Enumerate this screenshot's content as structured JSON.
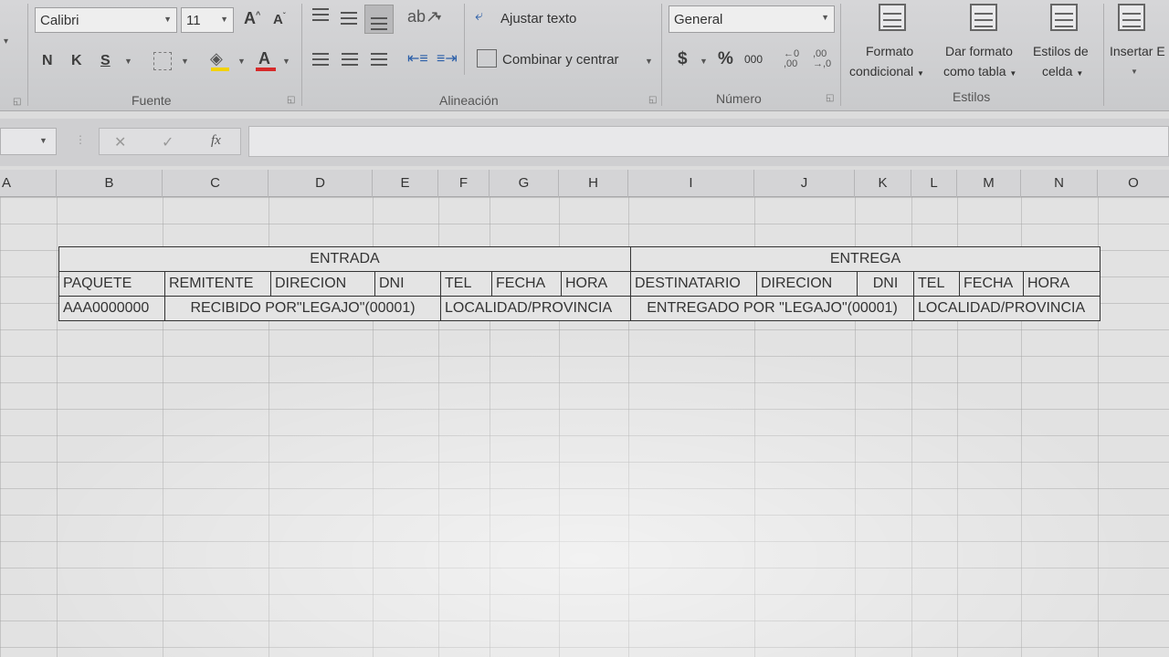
{
  "ribbon": {
    "font": {
      "name": "Calibri",
      "size": "11",
      "increase_font_label": "A",
      "decrease_font_label": "A",
      "bold_label": "N",
      "italic_label": "K",
      "underline_label": "S",
      "group_label": "Fuente",
      "font_color": "#d62a2a"
    },
    "alignment": {
      "wrap_text_label": "Ajustar texto",
      "merge_center_label": "Combinar y centrar",
      "group_label": "Alineación"
    },
    "number": {
      "format": "General",
      "currency_label": "$",
      "percent_label": "%",
      "thousands_label": "000",
      "group_label": "Número"
    },
    "styles": {
      "conditional_label_1": "Formato",
      "conditional_label_2": "condicional",
      "table_label_1": "Dar formato",
      "table_label_2": "como tabla",
      "cell_styles_label_1": "Estilos de",
      "cell_styles_label_2": "celda",
      "group_label": "Estilos"
    },
    "cells": {
      "insert_label": "Insertar E"
    }
  },
  "formula_bar": {
    "cancel_glyph": "✕",
    "enter_glyph": "✓",
    "fx_label": "fx",
    "value": ""
  },
  "columns": [
    "A",
    "B",
    "C",
    "D",
    "E",
    "F",
    "G",
    "H",
    "I",
    "J",
    "K",
    "L",
    "M",
    "N",
    "O"
  ],
  "sheet_table": {
    "entrada_header": "ENTRADA",
    "entrega_header": "ENTREGA",
    "headers_row": [
      "PAQUETE",
      "REMITENTE",
      "DIRECION",
      "DNI",
      "TEL",
      "FECHA",
      "HORA",
      "DESTINATARIO",
      "DIRECION",
      "DNI",
      "TEL",
      "FECHA",
      "HORA"
    ],
    "data_row": {
      "paquete": "AAA0000000",
      "recibido": "RECIBIDO POR\"LEGAJO\"(00001)",
      "localidad_entrada": "LOCALIDAD/PROVINCIA",
      "entregado": "ENTREGADO POR \"LEGAJO\"(00001)",
      "localidad_entrega": "LOCALIDAD/PROVINCIA"
    }
  }
}
